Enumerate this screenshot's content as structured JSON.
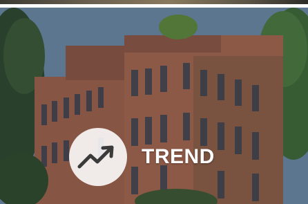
{
  "banner": {
    "label": "TREND",
    "icon": "trending-up-icon"
  },
  "colors": {
    "label": "#ffffff",
    "badge": "#f2f2f2",
    "icon": "#3a3a3a"
  }
}
